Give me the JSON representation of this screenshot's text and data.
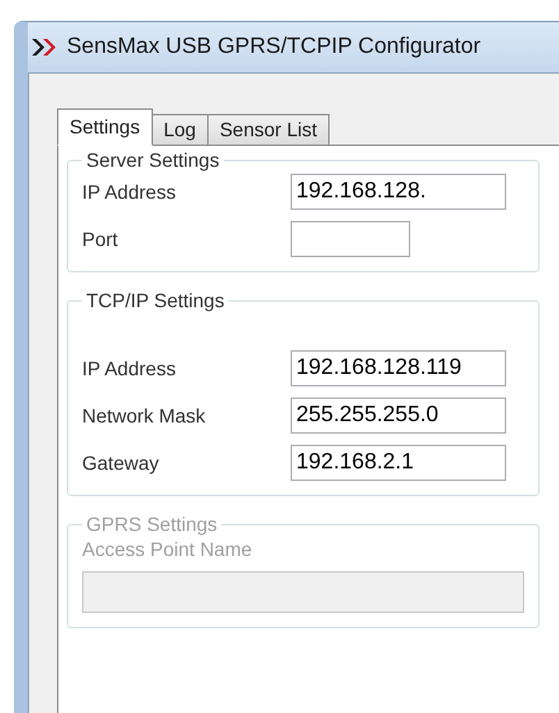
{
  "window": {
    "title": "SensMax USB GPRS/TCPIP Configurator"
  },
  "tabs": [
    {
      "label": "Settings",
      "selected": true
    },
    {
      "label": "Log",
      "selected": false
    },
    {
      "label": "Sensor List",
      "selected": false
    }
  ],
  "groups": [
    {
      "title": "Server Settings",
      "disabled": false,
      "fields": [
        {
          "label": "IP Address",
          "value": "192.168.128.",
          "kind": "wide"
        },
        {
          "label": "Port",
          "kind": "short"
        }
      ]
    },
    {
      "title": "TCP/IP Settings",
      "disabled": false,
      "fields": [
        {
          "label": "IP Address",
          "value": "192.168.128.119",
          "kind": "wide"
        },
        {
          "label": "Network Mask",
          "value": "255.255.255.0",
          "kind": "wide"
        },
        {
          "label": "Gateway",
          "value": "192.168.2.1",
          "kind": "wide"
        }
      ]
    },
    {
      "title": "GPRS Settings",
      "disabled": true,
      "fields": [
        {
          "label": "Access Point Name",
          "kind": "block"
        }
      ]
    }
  ]
}
